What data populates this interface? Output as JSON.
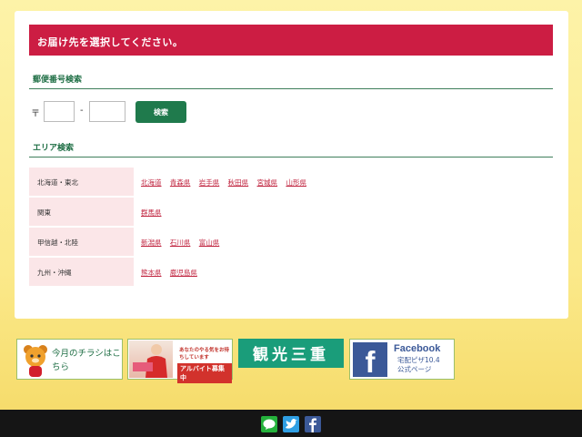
{
  "notice": "お届け先を選択してください。",
  "zip_section": {
    "title": "郵便番号検索",
    "mark": "〒",
    "dash": "-",
    "first_value": "",
    "second_value": "",
    "search_label": "検索"
  },
  "area_section": {
    "title": "エリア検索",
    "rows": [
      {
        "region": "北海道・東北",
        "prefectures": [
          "北海道",
          "青森県",
          "岩手県",
          "秋田県",
          "宮城県",
          "山形県"
        ]
      },
      {
        "region": "関東",
        "prefectures": [
          "群馬県"
        ]
      },
      {
        "region": "甲信越・北陸",
        "prefectures": [
          "新潟県",
          "石川県",
          "富山県"
        ]
      },
      {
        "region": "九州・沖縄",
        "prefectures": [
          "熊本県",
          "鹿児島県"
        ]
      }
    ]
  },
  "banners": {
    "flyer": "今月のチラシはこちら",
    "recruit_tagline": "あなたのやる気をお待ちしています",
    "recruit_label": "アルバイト募集中",
    "kanko": "観光三重",
    "facebook_title": "Facebook",
    "facebook_sub1": "宅配ピザ10.4",
    "facebook_sub2": "公式ページ"
  },
  "colors": {
    "notice_bg": "#cc1d43",
    "accent_green": "#1f7a4c",
    "link_red": "#c0243f",
    "region_bg": "#fbe6e8",
    "footer_bg": "#151515"
  },
  "icons": [
    "line-icon",
    "twitter-icon",
    "facebook-icon"
  ]
}
